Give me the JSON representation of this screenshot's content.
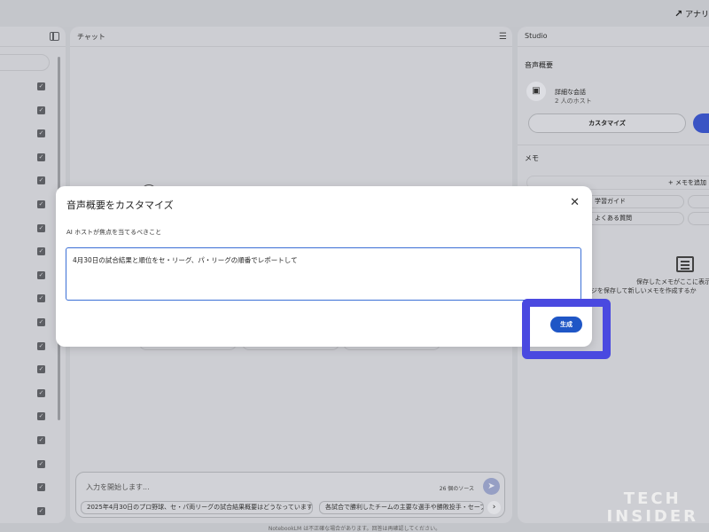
{
  "topbar": {
    "analysis_label": "アナリ"
  },
  "sources_panel": {
    "checked_count": 20
  },
  "chat_panel": {
    "title": "チャット",
    "input_placeholder": "入力を開始します...",
    "source_count": "26 個のソース",
    "suggestions": [
      "2025年4月30日のプロ野球、セ・パ両リーグの試合結果概要はどうなっていますか？",
      "各試合で勝利したチームの主要な選手や勝敗投手・セーブ投"
    ]
  },
  "studio_panel": {
    "title": "Studio",
    "audio_overview_label": "音声概要",
    "audio_title": "詳細な会話",
    "audio_subtitle": "2 人のホスト",
    "customize_button": "カスタマイズ",
    "memo_label": "メモ",
    "add_memo_button": "+ メモを追加",
    "chips": [
      "学習ガイド",
      "よくある質問"
    ],
    "empty_text_1": "保存したメモがここに表示",
    "empty_text_2": "セージを保存して新しいメモを作成するか"
  },
  "dialog": {
    "title": "音声概要をカスタマイズ",
    "close_icon": "close-icon",
    "prompt_label": "AI ホストが焦点を当てるべきこと",
    "prompt_value": "4月30日の試合結果と順位をセ・リーグ、パ・リーグの順番でレポートして",
    "generate_button": "生成"
  },
  "footer": {
    "disclaimer": "NotebookLM は不正確な場合があります。回答は再確認してください。"
  },
  "watermark": {
    "line1": "TECH",
    "line2": "INSIDER"
  },
  "colors": {
    "accent": "#1f56c6",
    "highlight": "#4a49e0"
  }
}
